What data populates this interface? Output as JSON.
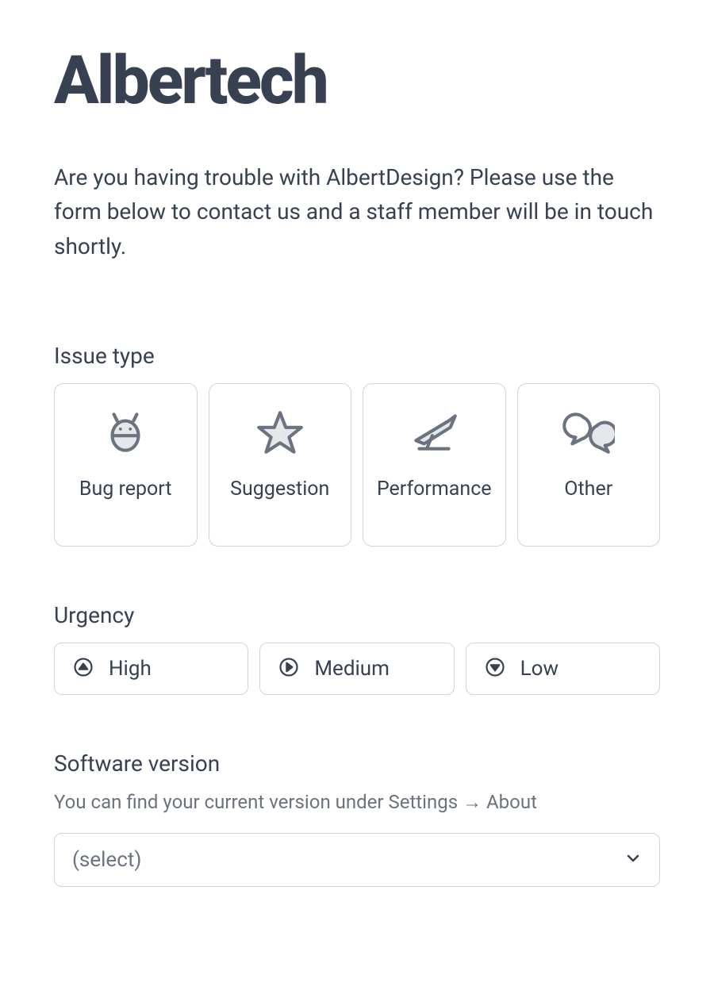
{
  "header": {
    "brand": "Albertech",
    "intro": "Are you having trouble with AlbertDesign? Please use the form below to contact us and a staff member will be in touch shortly."
  },
  "issue_type": {
    "label": "Issue type",
    "options": {
      "bug": "Bug report",
      "suggestion": "Suggestion",
      "performance": "Performance",
      "other": "Other"
    }
  },
  "urgency": {
    "label": "Urgency",
    "options": {
      "high": "High",
      "medium": "Medium",
      "low": "Low"
    }
  },
  "version": {
    "label": "Software version",
    "helper": "You can find your current version under Settings → About",
    "placeholder": "(select)"
  }
}
